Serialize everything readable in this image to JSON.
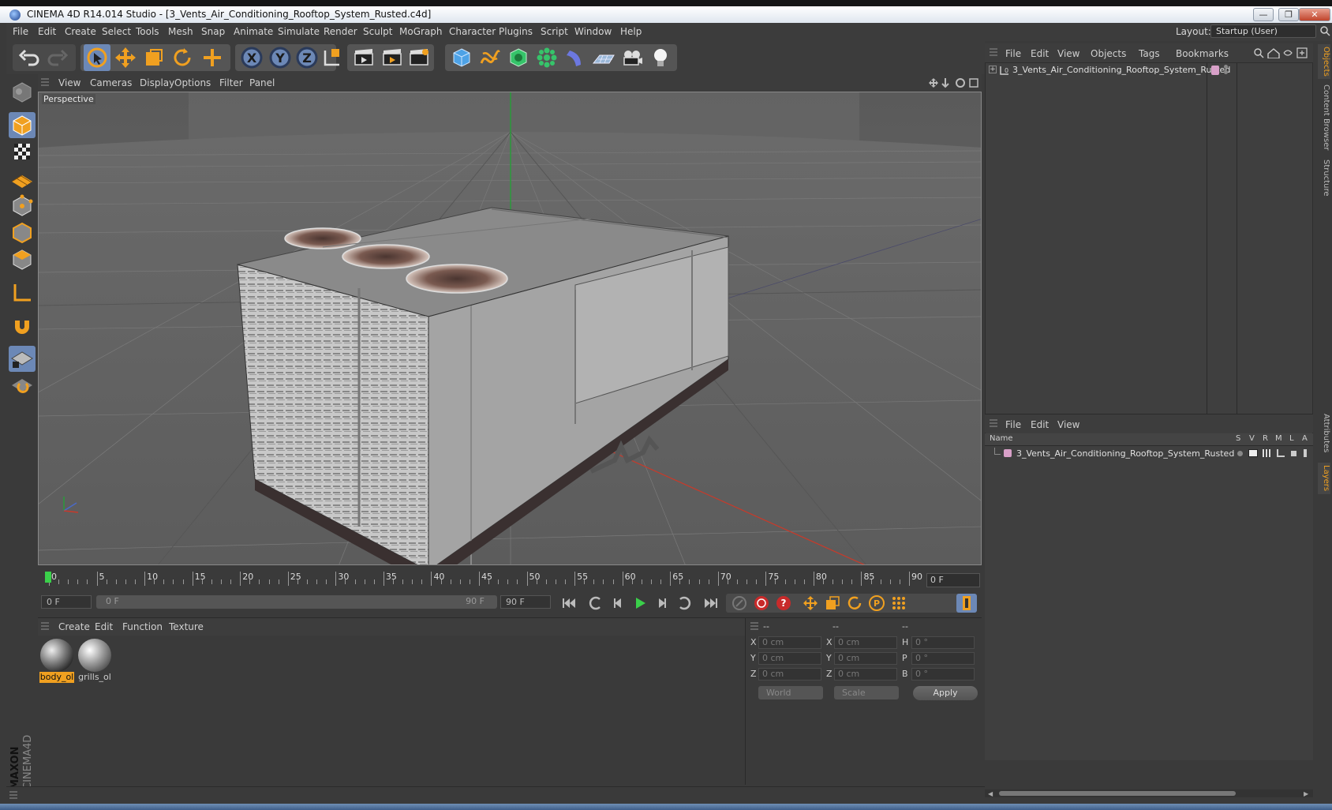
{
  "window": {
    "title": "CINEMA 4D R14.014 Studio - [3_Vents_Air_Conditioning_Rooftop_System_Rusted.c4d]",
    "btn_min": "—",
    "btn_max": "❐",
    "btn_close": "✕"
  },
  "menubar": {
    "items": [
      "File",
      "Edit",
      "Create",
      "Select",
      "Tools",
      "Mesh",
      "Snap",
      "Animate",
      "Simulate",
      "Render",
      "Sculpt",
      "MoGraph",
      "Character",
      "Plugins",
      "Script",
      "Window",
      "Help"
    ],
    "layout_label": "Layout:",
    "layout_value": "Startup (User)"
  },
  "viewport": {
    "menu": [
      "View",
      "Cameras",
      "Display",
      "Options",
      "Filter",
      "Panel"
    ],
    "camera_label": "Perspective"
  },
  "timeline": {
    "ticks": [
      "0",
      "5",
      "10",
      "15",
      "20",
      "25",
      "30",
      "35",
      "40",
      "45",
      "50",
      "55",
      "60",
      "65",
      "70",
      "75",
      "80",
      "85",
      "90"
    ],
    "current_frame": "0 F"
  },
  "playbar": {
    "start_field": "0 F",
    "range_start": "0 F",
    "range_end": "90 F",
    "end_field": "90 F"
  },
  "materials": {
    "menu": [
      "Create",
      "Edit",
      "Function",
      "Texture"
    ],
    "items": [
      {
        "label": "body_ol",
        "selected": true
      },
      {
        "label": "grills_ol",
        "selected": false
      }
    ]
  },
  "coordinates": {
    "col_headers": [
      "--",
      "--",
      "--"
    ],
    "rows": [
      {
        "pos_label": "X",
        "pos_value": "0 cm",
        "size_label": "X",
        "size_value": "0 cm",
        "rot_label": "H",
        "rot_value": "0 °"
      },
      {
        "pos_label": "Y",
        "pos_value": "0 cm",
        "size_label": "Y",
        "size_value": "0 cm",
        "rot_label": "P",
        "rot_value": "0 °"
      },
      {
        "pos_label": "Z",
        "pos_value": "0 cm",
        "size_label": "Z",
        "size_value": "0 cm",
        "rot_label": "B",
        "rot_value": "0 °"
      }
    ],
    "space_dropdown": "World",
    "mode_dropdown": "Scale",
    "apply_label": "Apply"
  },
  "objects_panel": {
    "menu": [
      "File",
      "Edit",
      "View",
      "Objects",
      "Tags",
      "Bookmarks"
    ],
    "items": [
      "3_Vents_Air_Conditioning_Rooftop_System_Rusted"
    ]
  },
  "layers_panel": {
    "menu": [
      "File",
      "Edit",
      "View"
    ],
    "columns": [
      "Name",
      "S",
      "V",
      "R",
      "M",
      "L",
      "A"
    ],
    "items": [
      "3_Vents_Air_Conditioning_Rooftop_System_Rusted"
    ]
  },
  "side_tabs": [
    "Objects",
    "Content Browser",
    "Structure",
    "Attributes",
    "Layers"
  ],
  "branding": {
    "maxon": "MAXON",
    "product": "CINEMA4D"
  },
  "colors": {
    "accent_orange": "#f0a020",
    "selected_blue": "#4a78b0",
    "axis_x": "#c83a2a",
    "axis_y": "#2a9a3a",
    "layer_color": "#d8a0c8"
  }
}
